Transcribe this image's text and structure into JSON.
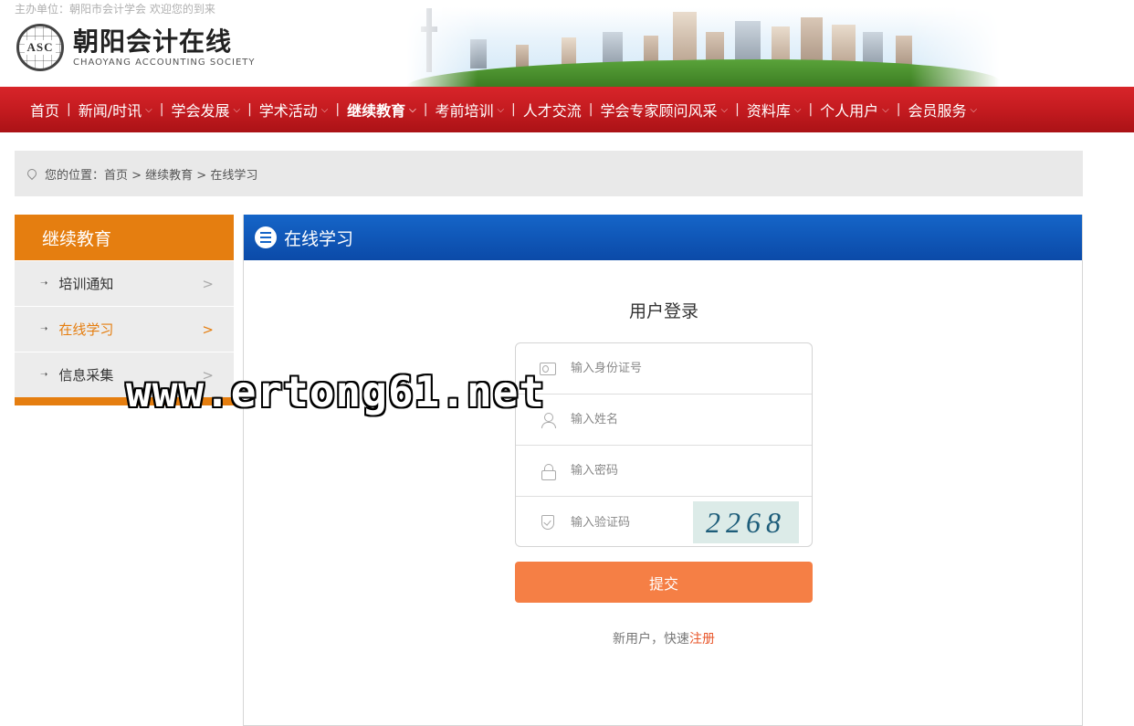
{
  "host_line": "主办单位：朝阳市会计学会 欢迎您的到来",
  "logo": {
    "badge": "ASC",
    "name_cn": "朝阳会计在线",
    "name_en": "CHAOYANG ACCOUNTING SOCIETY"
  },
  "nav": {
    "items": [
      {
        "label": "首页",
        "chevron": false,
        "bold": false
      },
      {
        "label": "新闻/时讯",
        "chevron": true,
        "bold": false
      },
      {
        "label": "学会发展",
        "chevron": true,
        "bold": false
      },
      {
        "label": "学术活动",
        "chevron": true,
        "bold": false
      },
      {
        "label": "继续教育",
        "chevron": true,
        "bold": true
      },
      {
        "label": "考前培训",
        "chevron": true,
        "bold": false
      },
      {
        "label": "人才交流",
        "chevron": false,
        "bold": false
      },
      {
        "label": "学会专家顾问风采",
        "chevron": true,
        "bold": false
      },
      {
        "label": "资料库",
        "chevron": true,
        "bold": false
      },
      {
        "label": "个人用户",
        "chevron": true,
        "bold": false
      },
      {
        "label": "会员服务",
        "chevron": true,
        "bold": false
      }
    ]
  },
  "breadcrumb": {
    "text": "您的位置：首页 > 继续教育 > 在线学习"
  },
  "sidebar": {
    "title": "继续教育",
    "items": [
      {
        "label": "培训通知",
        "arrow": ">",
        "active": false
      },
      {
        "label": "在线学习",
        "arrow": ">",
        "active": true
      },
      {
        "label": "信息采集",
        "arrow": ">",
        "active": false
      }
    ]
  },
  "panel": {
    "title": "在线学习"
  },
  "login": {
    "title": "用户登录",
    "id_placeholder": "输入身份证号",
    "name_placeholder": "输入姓名",
    "password_placeholder": "输入密码",
    "captcha_placeholder": "输入验证码",
    "captcha_value": "2268",
    "submit_label": "提交",
    "signup_prefix": "新用户，快速",
    "signup_link": "注册"
  },
  "watermark": "www.ertong61.net",
  "colors": {
    "nav_red": "#c21a1f",
    "side_orange": "#e57e10",
    "panel_blue": "#1565c8",
    "submit_orange": "#f57f45"
  }
}
